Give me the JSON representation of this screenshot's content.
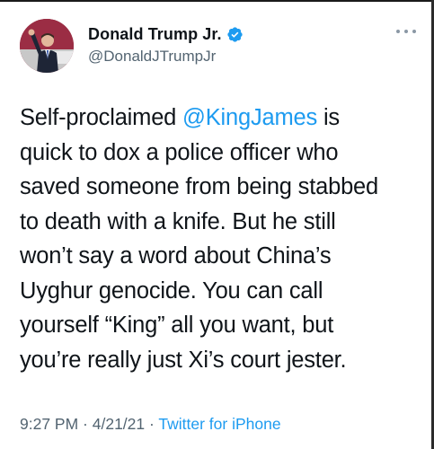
{
  "tweet": {
    "author": {
      "display_name": "Donald Trump Jr.",
      "handle": "@DonaldJTrumpJr",
      "verified": true,
      "verified_icon": "verified-badge-icon"
    },
    "body_lines": [
      {
        "pre": "Self-proclaimed ",
        "mention": "@KingJames",
        "post": " is"
      },
      {
        "text": "quick to dox a police officer who"
      },
      {
        "text": "saved someone from being stabbed"
      },
      {
        "text": "to death with a knife. But he still"
      },
      {
        "text": "won’t say a word about China’s"
      },
      {
        "text": "Uyghur genocide. You can call"
      },
      {
        "text": "yourself “King” all you want, but"
      },
      {
        "text": "you’re really just Xi’s court jester."
      }
    ],
    "time": "9:27 PM",
    "sep1": " · ",
    "date": "4/21/21",
    "sep2": " · ",
    "source": "Twitter for iPhone"
  },
  "colors": {
    "text": "#0f1419",
    "secondary": "#536471",
    "accent": "#1d9bf0"
  },
  "icons": {
    "more": "more-options-icon"
  }
}
